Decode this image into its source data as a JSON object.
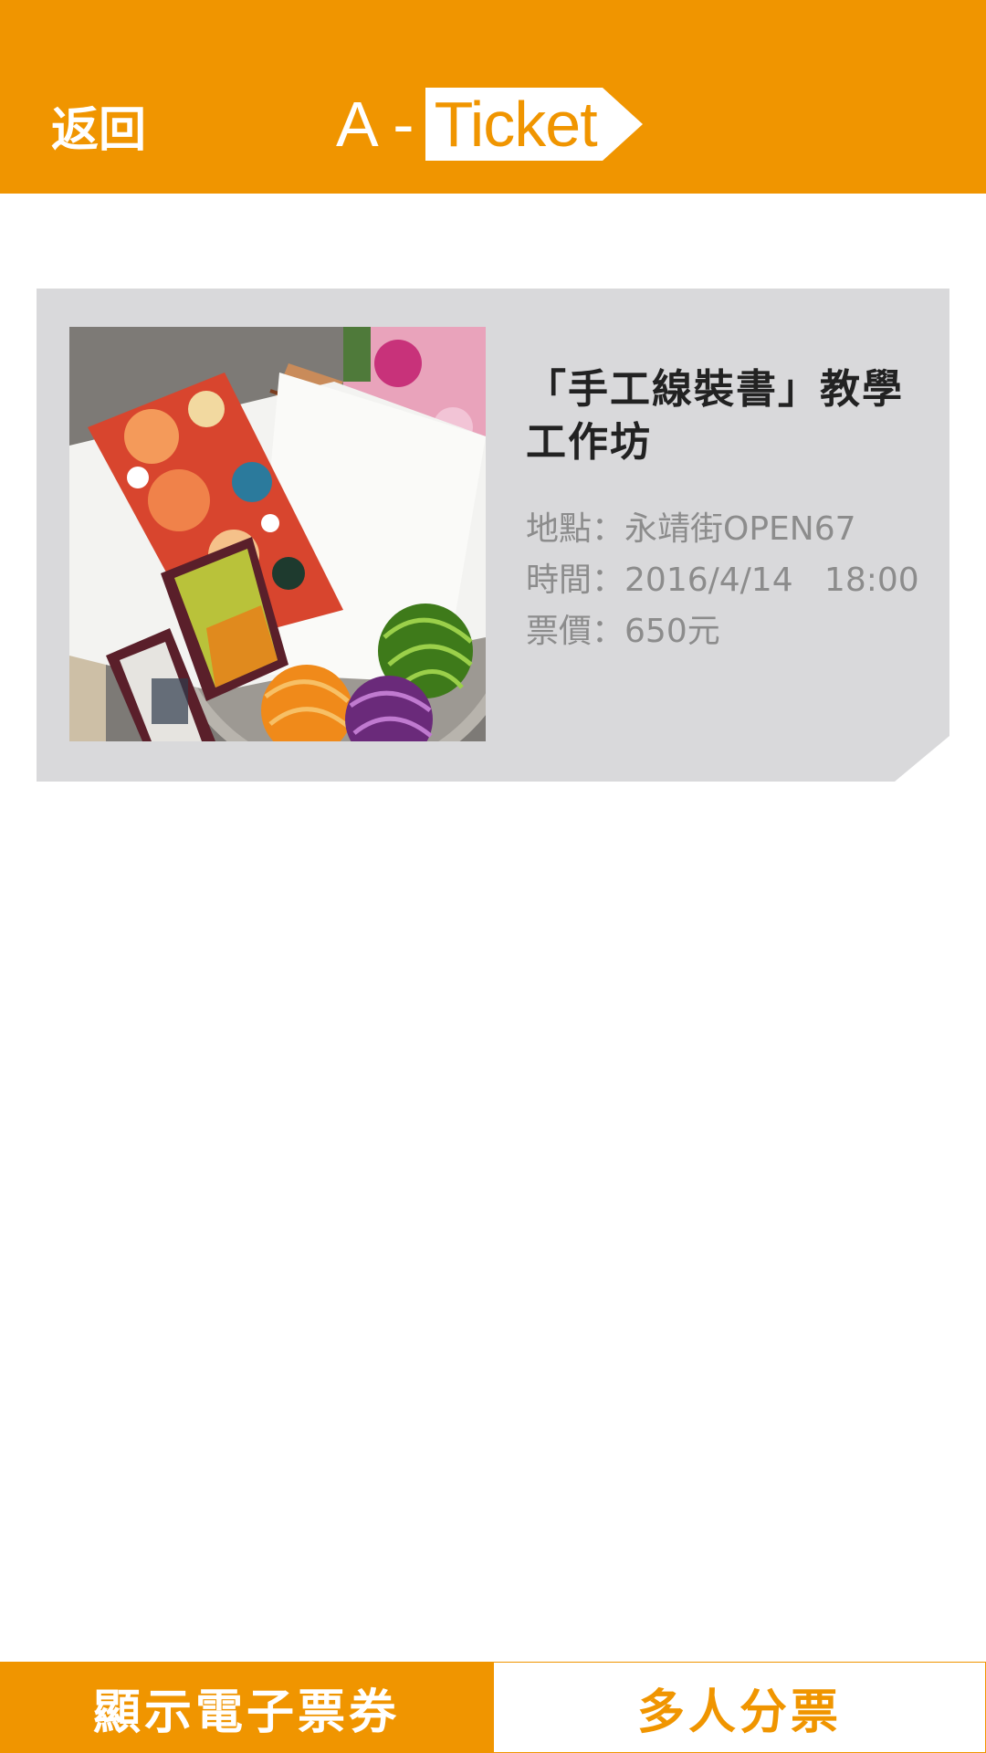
{
  "header": {
    "back_label": "返回",
    "logo_prefix": "A -",
    "logo_tag": "Ticket"
  },
  "event": {
    "title": "「手工線裝書」教學工作坊",
    "location_label": "地點：",
    "location": "永靖街OPEN67",
    "time_label": "時間：",
    "time": "2016/4/14   18:00",
    "price_label": "票價：",
    "price": "650元"
  },
  "bottom_bar": {
    "show_ticket_label": "顯示電子票券",
    "split_ticket_label": "多人分票"
  },
  "colors": {
    "brand_orange": "#f09500",
    "card_gray": "#d9d9db",
    "text_dark": "#222222",
    "text_muted": "#8c8c8c"
  }
}
